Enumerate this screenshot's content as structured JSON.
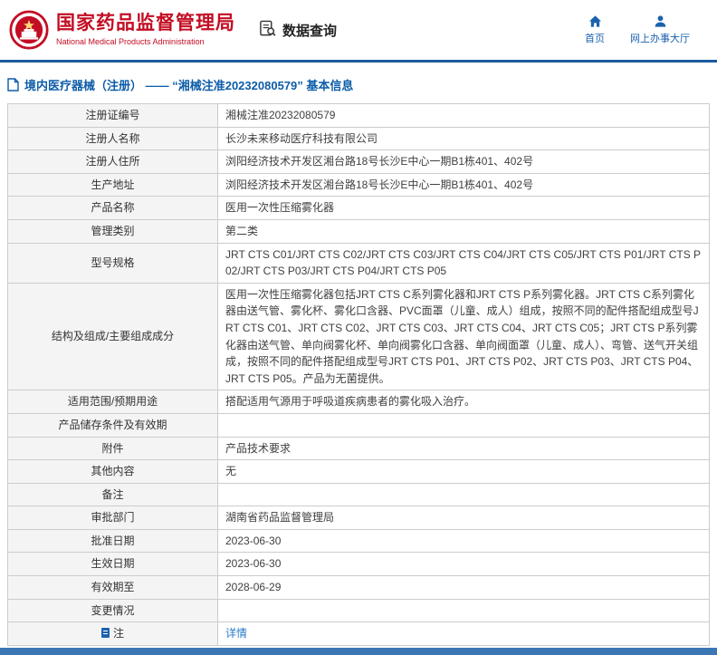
{
  "header": {
    "org_name_cn": "国家药品监督管理局",
    "org_name_en": "National Medical Products Administration",
    "section_title": "数据查询",
    "nav": [
      {
        "label": "首页",
        "icon": "home-icon"
      },
      {
        "label": "网上办事大厅",
        "icon": "user-icon"
      }
    ]
  },
  "breadcrumb": {
    "text": "境内医疗器械（注册） ——  “湘械注准20232080579”  基本信息"
  },
  "table": {
    "rows": [
      {
        "label": "注册证编号",
        "value": "湘械注准20232080579"
      },
      {
        "label": "注册人名称",
        "value": "长沙未来移动医疗科技有限公司"
      },
      {
        "label": "注册人住所",
        "value": "浏阳经济技术开发区湘台路18号长沙E中心一期B1栋401、402号"
      },
      {
        "label": "生产地址",
        "value": "浏阳经济技术开发区湘台路18号长沙E中心一期B1栋401、402号"
      },
      {
        "label": "产品名称",
        "value": "医用一次性压缩雾化器"
      },
      {
        "label": "管理类别",
        "value": "第二类"
      },
      {
        "label": "型号规格",
        "value": "JRT CTS C01/JRT CTS C02/JRT CTS C03/JRT CTS C04/JRT CTS C05/JRT CTS P01/JRT CTS P02/JRT CTS P03/JRT CTS P04/JRT CTS P05"
      },
      {
        "label": "结构及组成/主要组成成分",
        "value": "医用一次性压缩雾化器包括JRT CTS C系列雾化器和JRT CTS P系列雾化器。JRT CTS C系列雾化器由送气管、雾化杯、雾化口含器、PVC面罩（儿童、成人）组成，按照不同的配件搭配组成型号JRT CTS C01、JRT CTS C02、JRT CTS C03、JRT CTS C04、JRT CTS C05；JRT CTS P系列雾化器由送气管、单向阀雾化杯、单向阀雾化口含器、单向阀面罩（儿童、成人）、弯管、送气开关组成，按照不同的配件搭配组成型号JRT CTS P01、JRT CTS P02、JRT CTS P03、JRT CTS P04、JRT CTS P05。产品为无菌提供。"
      },
      {
        "label": "适用范围/预期用途",
        "value": "搭配适用气源用于呼吸道疾病患者的雾化吸入治疗。"
      },
      {
        "label": "产品储存条件及有效期",
        "value": ""
      },
      {
        "label": "附件",
        "value": "产品技术要求"
      },
      {
        "label": "其他内容",
        "value": "无"
      },
      {
        "label": "备注",
        "value": ""
      },
      {
        "label": "审批部门",
        "value": "湖南省药品监督管理局"
      },
      {
        "label": "批准日期",
        "value": "2023-06-30"
      },
      {
        "label": "生效日期",
        "value": "2023-06-30"
      },
      {
        "label": "有效期至",
        "value": "2028-06-29"
      },
      {
        "label": "变更情况",
        "value": ""
      },
      {
        "label": "注",
        "icon": "note-icon",
        "value": "详情",
        "link": true
      }
    ]
  },
  "colors": {
    "brand_red": "#c30d23",
    "nav_blue": "#1b62ae",
    "divider_blue": "#1c5aa0",
    "crumb_blue": "#0d5ca8",
    "link_blue": "#2a7cc8",
    "label_bg": "#f4f4f4",
    "footer_blue": "#3b77b5"
  }
}
